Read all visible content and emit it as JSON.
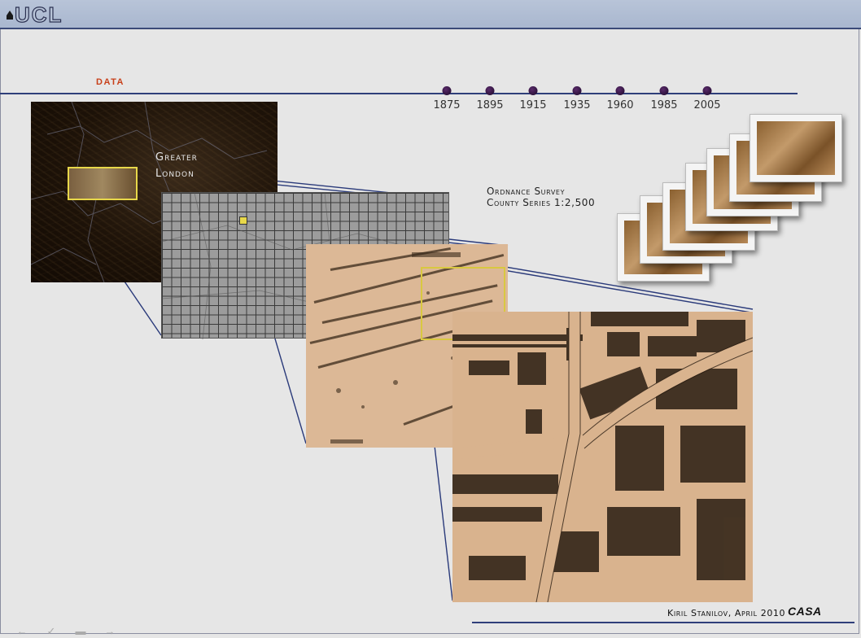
{
  "header": {
    "logo_text": "UCL"
  },
  "section_title": "DATA",
  "timeline": {
    "years": [
      "1875",
      "1895",
      "1915",
      "1935",
      "1960",
      "1985",
      "2005"
    ]
  },
  "map_overview": {
    "label_line1": "Greater",
    "label_line2": "London"
  },
  "survey_label": {
    "line1": "Ordnance Survey",
    "line2": "County Series 1:2,500"
  },
  "credit": {
    "author": "Kiril Stanilov, April 2010",
    "org": "CASA"
  },
  "navigation": {
    "icons": [
      "back-arrow-icon",
      "check-icon",
      "menu-icon",
      "forward-arrow-icon"
    ]
  },
  "colors": {
    "header_bg": "#b1bdd3",
    "rule": "#2f3f7a",
    "section_title": "#c8401a",
    "highlight": "#e8d84a",
    "sepia": "#d9b38e"
  }
}
